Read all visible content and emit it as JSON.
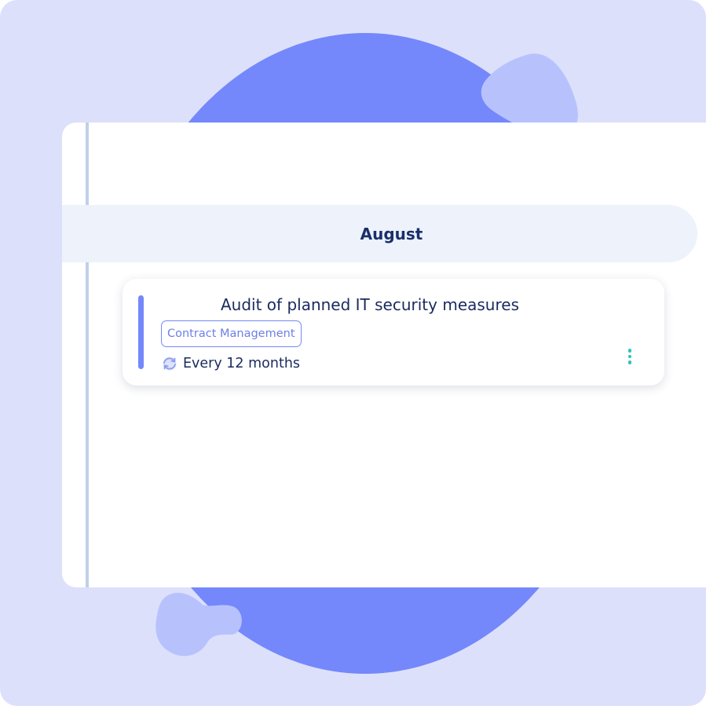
{
  "colors": {
    "background": "#dde0fa",
    "accent": "#7488fb",
    "accent_light": "#b7c2fd",
    "month_bar": "#edf2fb",
    "title_text": "#1a2a5e",
    "menu_dots": "#2fc3bb"
  },
  "timeline": {
    "month": "August",
    "tasks": [
      {
        "title": "Audit of planned IT security measures",
        "tag": "Contract Management",
        "recurrence_icon": "refresh-cycle-icon",
        "recurrence": "Every 12 months",
        "menu_icon": "more-vertical-icon"
      }
    ]
  }
}
